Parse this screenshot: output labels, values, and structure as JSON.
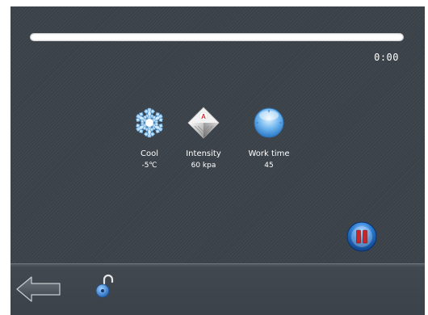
{
  "player": {
    "progress": 0.0,
    "time_label": "0:00"
  },
  "params": [
    {
      "label": "Cool",
      "value": "-5℃",
      "icon": "snowflake-icon"
    },
    {
      "label": "Intensity",
      "value": "60 kpa",
      "icon": "intensity-diamond-icon"
    },
    {
      "label": "Work time",
      "value": "45",
      "icon": "clock-icon"
    }
  ],
  "controls": {
    "pause_icon": "pause-icon",
    "back_icon": "back-arrow-icon",
    "lock_icon": "unlock-icon"
  },
  "colors": {
    "background": "#3a4148",
    "text": "#ffffff",
    "pause_accent": "#c62828",
    "button_blue": "#1f6fc4"
  }
}
